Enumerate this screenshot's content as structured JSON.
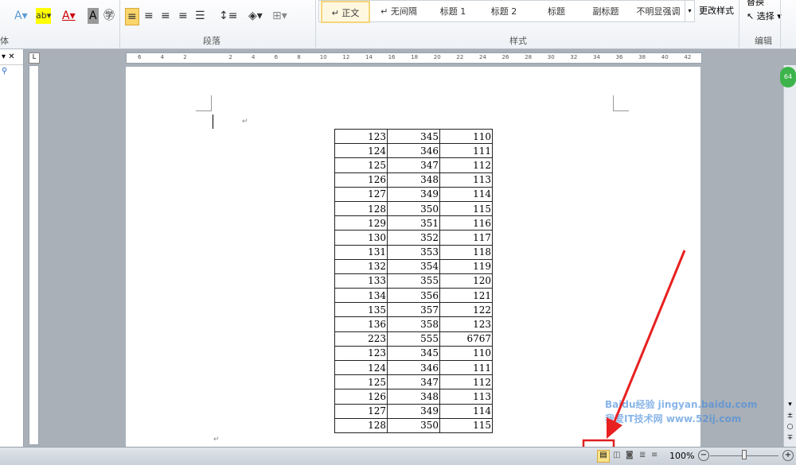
{
  "ribbon": {
    "font_group_label": "体",
    "paragraph_group_label": "段落",
    "styles_group_label": "样式",
    "editing_group_label": "编辑",
    "styles": [
      "↵ 正文",
      "↵ 无间隔",
      "标题 1",
      "标题 2",
      "标题",
      "副标题",
      "不明显强调"
    ],
    "change_styles": "更改样式",
    "replace": "替换",
    "select": "选择"
  },
  "ruler": {
    "ticks": [
      "6",
      "4",
      "2",
      "",
      "2",
      "4",
      "6",
      "8",
      "10",
      "12",
      "14",
      "16",
      "18",
      "20",
      "22",
      "24",
      "26",
      "28",
      "30",
      "32",
      "34",
      "36",
      "38",
      "40",
      "42"
    ]
  },
  "table": {
    "rows": [
      [
        "123",
        "345",
        "110"
      ],
      [
        "124",
        "346",
        "111"
      ],
      [
        "125",
        "347",
        "112"
      ],
      [
        "126",
        "348",
        "113"
      ],
      [
        "127",
        "349",
        "114"
      ],
      [
        "128",
        "350",
        "115"
      ],
      [
        "129",
        "351",
        "116"
      ],
      [
        "130",
        "352",
        "117"
      ],
      [
        "131",
        "353",
        "118"
      ],
      [
        "132",
        "354",
        "119"
      ],
      [
        "133",
        "355",
        "120"
      ],
      [
        "134",
        "356",
        "121"
      ],
      [
        "135",
        "357",
        "122"
      ],
      [
        "136",
        "358",
        "123"
      ],
      [
        "223",
        "555",
        "6767"
      ],
      [
        "123",
        "345",
        "110"
      ],
      [
        "124",
        "346",
        "111"
      ],
      [
        "125",
        "347",
        "112"
      ],
      [
        "126",
        "348",
        "113"
      ],
      [
        "127",
        "349",
        "114"
      ],
      [
        "128",
        "350",
        "115"
      ]
    ]
  },
  "status": {
    "zoom": "100%"
  },
  "watermark": {
    "text": "Baidu经验 jingyan.baidu.com 我爱IT技术网 www.52ij.com"
  },
  "colors": {
    "highlight_box": "#e02020",
    "arrow": "#e82020"
  }
}
